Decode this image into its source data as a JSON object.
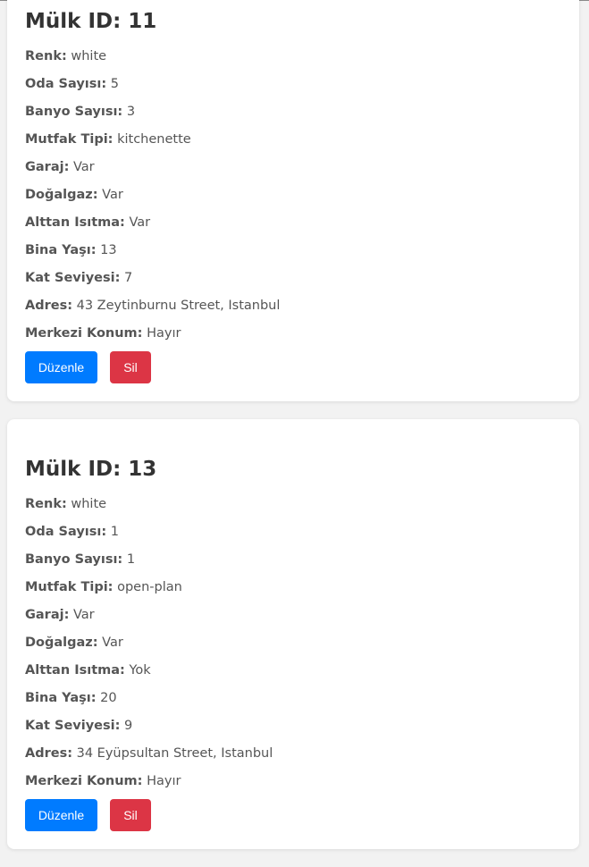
{
  "labels": {
    "id_prefix": "Mülk ID:",
    "renk": "Renk:",
    "oda": "Oda Sayısı:",
    "banyo": "Banyo Sayısı:",
    "mutfak": "Mutfak Tipi:",
    "garaj": "Garaj:",
    "dogalgaz": "Doğalgaz:",
    "alttan": "Alttan Isıtma:",
    "bina": "Bina Yaşı:",
    "kat": "Kat Seviyesi:",
    "adres": "Adres:",
    "merkezi": "Merkezi Konum:",
    "edit_button": "Düzenle",
    "delete_button": "Sil"
  },
  "properties": [
    {
      "title": "Mülk ID: 11",
      "renk": "white",
      "oda": "5",
      "banyo": "3",
      "mutfak": "kitchenette",
      "garaj": "Var",
      "dogalgaz": "Var",
      "alttan": "Var",
      "bina": "13",
      "kat": "7",
      "adres": "43 Zeytinburnu Street, Istanbul",
      "merkezi": "Hayır"
    },
    {
      "title": "Mülk ID: 13",
      "renk": "white",
      "oda": "1",
      "banyo": "1",
      "mutfak": "open-plan",
      "garaj": "Var",
      "dogalgaz": "Var",
      "alttan": "Yok",
      "bina": "20",
      "kat": "9",
      "adres": "34 Eyüpsultan Street, Istanbul",
      "merkezi": "Hayır"
    }
  ],
  "colors": {
    "edit_button": "#007bff",
    "delete_button": "#dc3545",
    "background": "#f2f2f2",
    "card": "#ffffff"
  }
}
